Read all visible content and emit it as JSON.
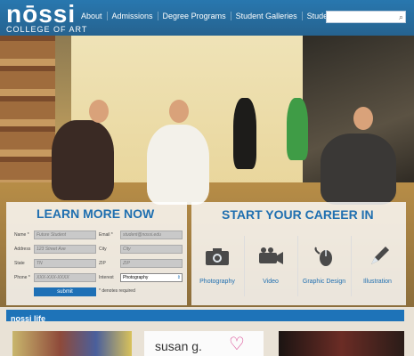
{
  "logo": {
    "word": "nōssi",
    "subtitle": "COLLEGE OF ART"
  },
  "nav": {
    "items": [
      "About",
      "Admissions",
      "Degree Programs",
      "Student Galleries",
      "Student Life"
    ]
  },
  "search": {
    "placeholder": ""
  },
  "learn": {
    "title": "LEARN MORE NOW",
    "fields": {
      "name_label": "Name *",
      "name_placeholder": "Future Student",
      "email_label": "Email *",
      "email_placeholder": "student@nossi.edu",
      "address_label": "Address",
      "address_placeholder": "123 Street Ave",
      "city_label": "City",
      "city_placeholder": "City",
      "state_label": "State",
      "state_placeholder": "TN",
      "zip_label": "ZIP",
      "zip_placeholder": "ZIP",
      "phone_label": "Phone *",
      "phone_placeholder": "XXX-XXX-XXXX",
      "interest_label": "Interest",
      "interest_value": "Photography"
    },
    "submit": "submit",
    "required_note": "* denotes required"
  },
  "career": {
    "title": "START YOUR CAREER IN",
    "items": [
      {
        "name": "Photography",
        "icon": "camera-icon"
      },
      {
        "name": "Video",
        "icon": "video-camera-icon"
      },
      {
        "name": "Graphic Design",
        "icon": "mouse-icon"
      },
      {
        "name": "Illustration",
        "icon": "pen-icon"
      }
    ]
  },
  "life": {
    "title": "nossi life",
    "thumb2_text": "susan g."
  },
  "colors": {
    "brand_blue": "#1f6fb0",
    "nav_blue": "#2478b4"
  }
}
